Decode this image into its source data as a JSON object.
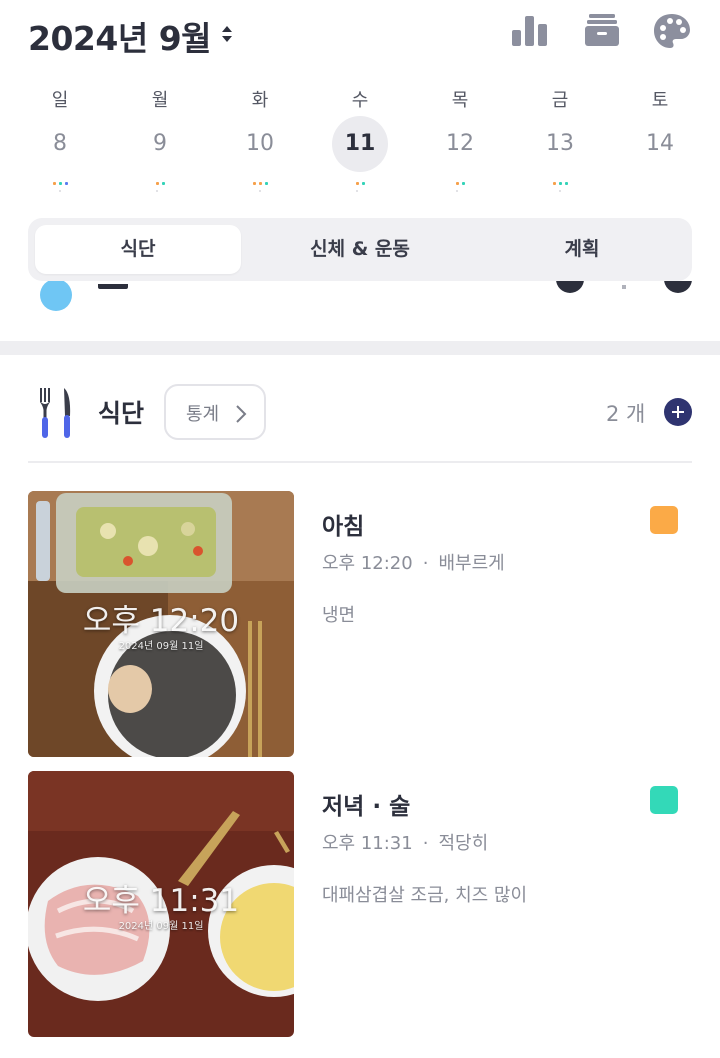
{
  "header": {
    "month_title": "2024년 9월",
    "icons": [
      "stats-icon",
      "box-icon",
      "palette-icon"
    ]
  },
  "week": {
    "days": [
      {
        "name": "일",
        "num": "8",
        "selected": false,
        "dots": [
          "#f6a04a",
          "#33d3b8",
          "#5a7cf0"
        ]
      },
      {
        "name": "월",
        "num": "9",
        "selected": false,
        "dots": [
          "#f6a04a",
          "#33d3b8"
        ]
      },
      {
        "name": "화",
        "num": "10",
        "selected": false,
        "dots": [
          "#f6a04a",
          "#f6a04a",
          "#33d3b8"
        ]
      },
      {
        "name": "수",
        "num": "11",
        "selected": true,
        "dots": [
          "#f6a04a",
          "#33d3b8"
        ]
      },
      {
        "name": "목",
        "num": "12",
        "selected": false,
        "dots": [
          "#f6a04a",
          "#33d3b8"
        ]
      },
      {
        "name": "금",
        "num": "13",
        "selected": false,
        "dots": [
          "#f6a04a",
          "#33d3b8",
          "#33d3b8"
        ]
      },
      {
        "name": "토",
        "num": "14",
        "selected": false,
        "dots": []
      }
    ]
  },
  "tabs": [
    {
      "label": "식단",
      "active": true
    },
    {
      "label": "신체 & 운동",
      "active": false
    },
    {
      "label": "계획",
      "active": false
    }
  ],
  "meal_section": {
    "title": "식단",
    "stats_label": "통계",
    "count": "2 개"
  },
  "meals": [
    {
      "name": "아침",
      "time": "오후 12:20",
      "fullness": "배부르게",
      "description": "냉면",
      "color": "#fbaa47",
      "photo_time": "오후 12:20",
      "photo_date": "2024년 09월 11일"
    },
    {
      "name": "저녁 · 술",
      "time": "오후 11:31",
      "fullness": "적당히",
      "description": "대패삼겹살 조금, 치즈 많이",
      "color": "#33d9b8",
      "photo_time": "오후 11:31",
      "photo_date": "2024년 09월 11일"
    }
  ],
  "colors": {
    "accent_add": "#2f3470",
    "selected_day_bg": "#ebebef",
    "tab_bg": "#f0f0f3"
  }
}
